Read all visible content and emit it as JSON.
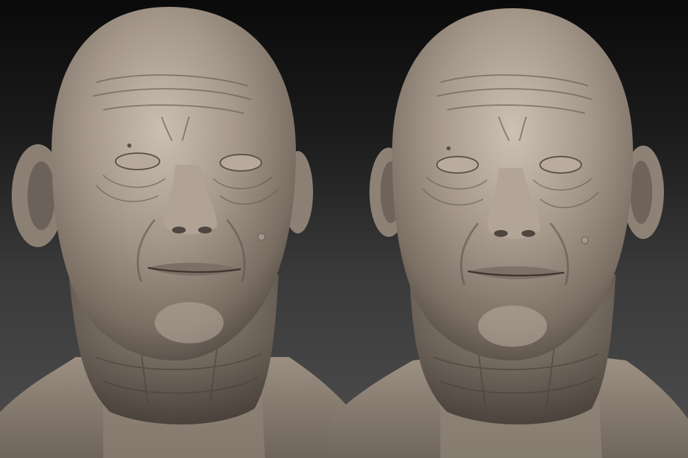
{
  "scene": {
    "background_top": "#0a0a0a",
    "background_bottom": "#4e4e4e",
    "material_color": "#a3968a",
    "material_highlight": "#c9bdb0",
    "material_shadow": "#5a5048"
  },
  "renders": [
    {
      "view": "front",
      "subject": "elderly-male-head-sculpt"
    },
    {
      "view": "front-slight-turn",
      "subject": "elderly-male-head-sculpt"
    }
  ]
}
